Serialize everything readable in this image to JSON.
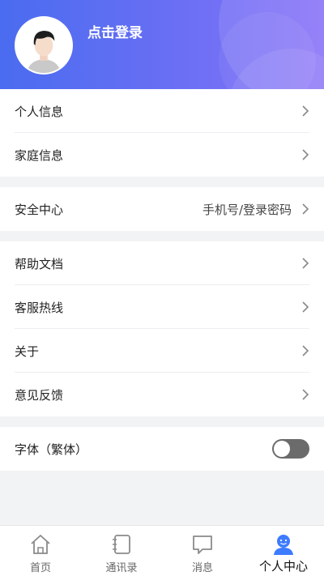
{
  "header": {
    "login_text": "点击登录"
  },
  "group1": [
    {
      "label": "个人信息"
    },
    {
      "label": "家庭信息"
    }
  ],
  "group2": [
    {
      "label": "安全中心",
      "value": "手机号/登录密码"
    }
  ],
  "group3": [
    {
      "label": "帮助文档"
    },
    {
      "label": "客服热线"
    },
    {
      "label": "关于"
    },
    {
      "label": "意见反馈"
    }
  ],
  "group4": {
    "label": "字体（繁体）",
    "toggle_on": false
  },
  "tabbar": [
    {
      "label": "首页",
      "icon": "home-icon",
      "active": false
    },
    {
      "label": "通讯录",
      "icon": "contacts-icon",
      "active": false
    },
    {
      "label": "消息",
      "icon": "message-icon",
      "active": false
    },
    {
      "label": "个人中心",
      "icon": "profile-icon",
      "active": true
    }
  ],
  "colors": {
    "accent": "#4a6cf0",
    "header_end": "#8a73f8",
    "active_tab": "#3d7bff"
  }
}
